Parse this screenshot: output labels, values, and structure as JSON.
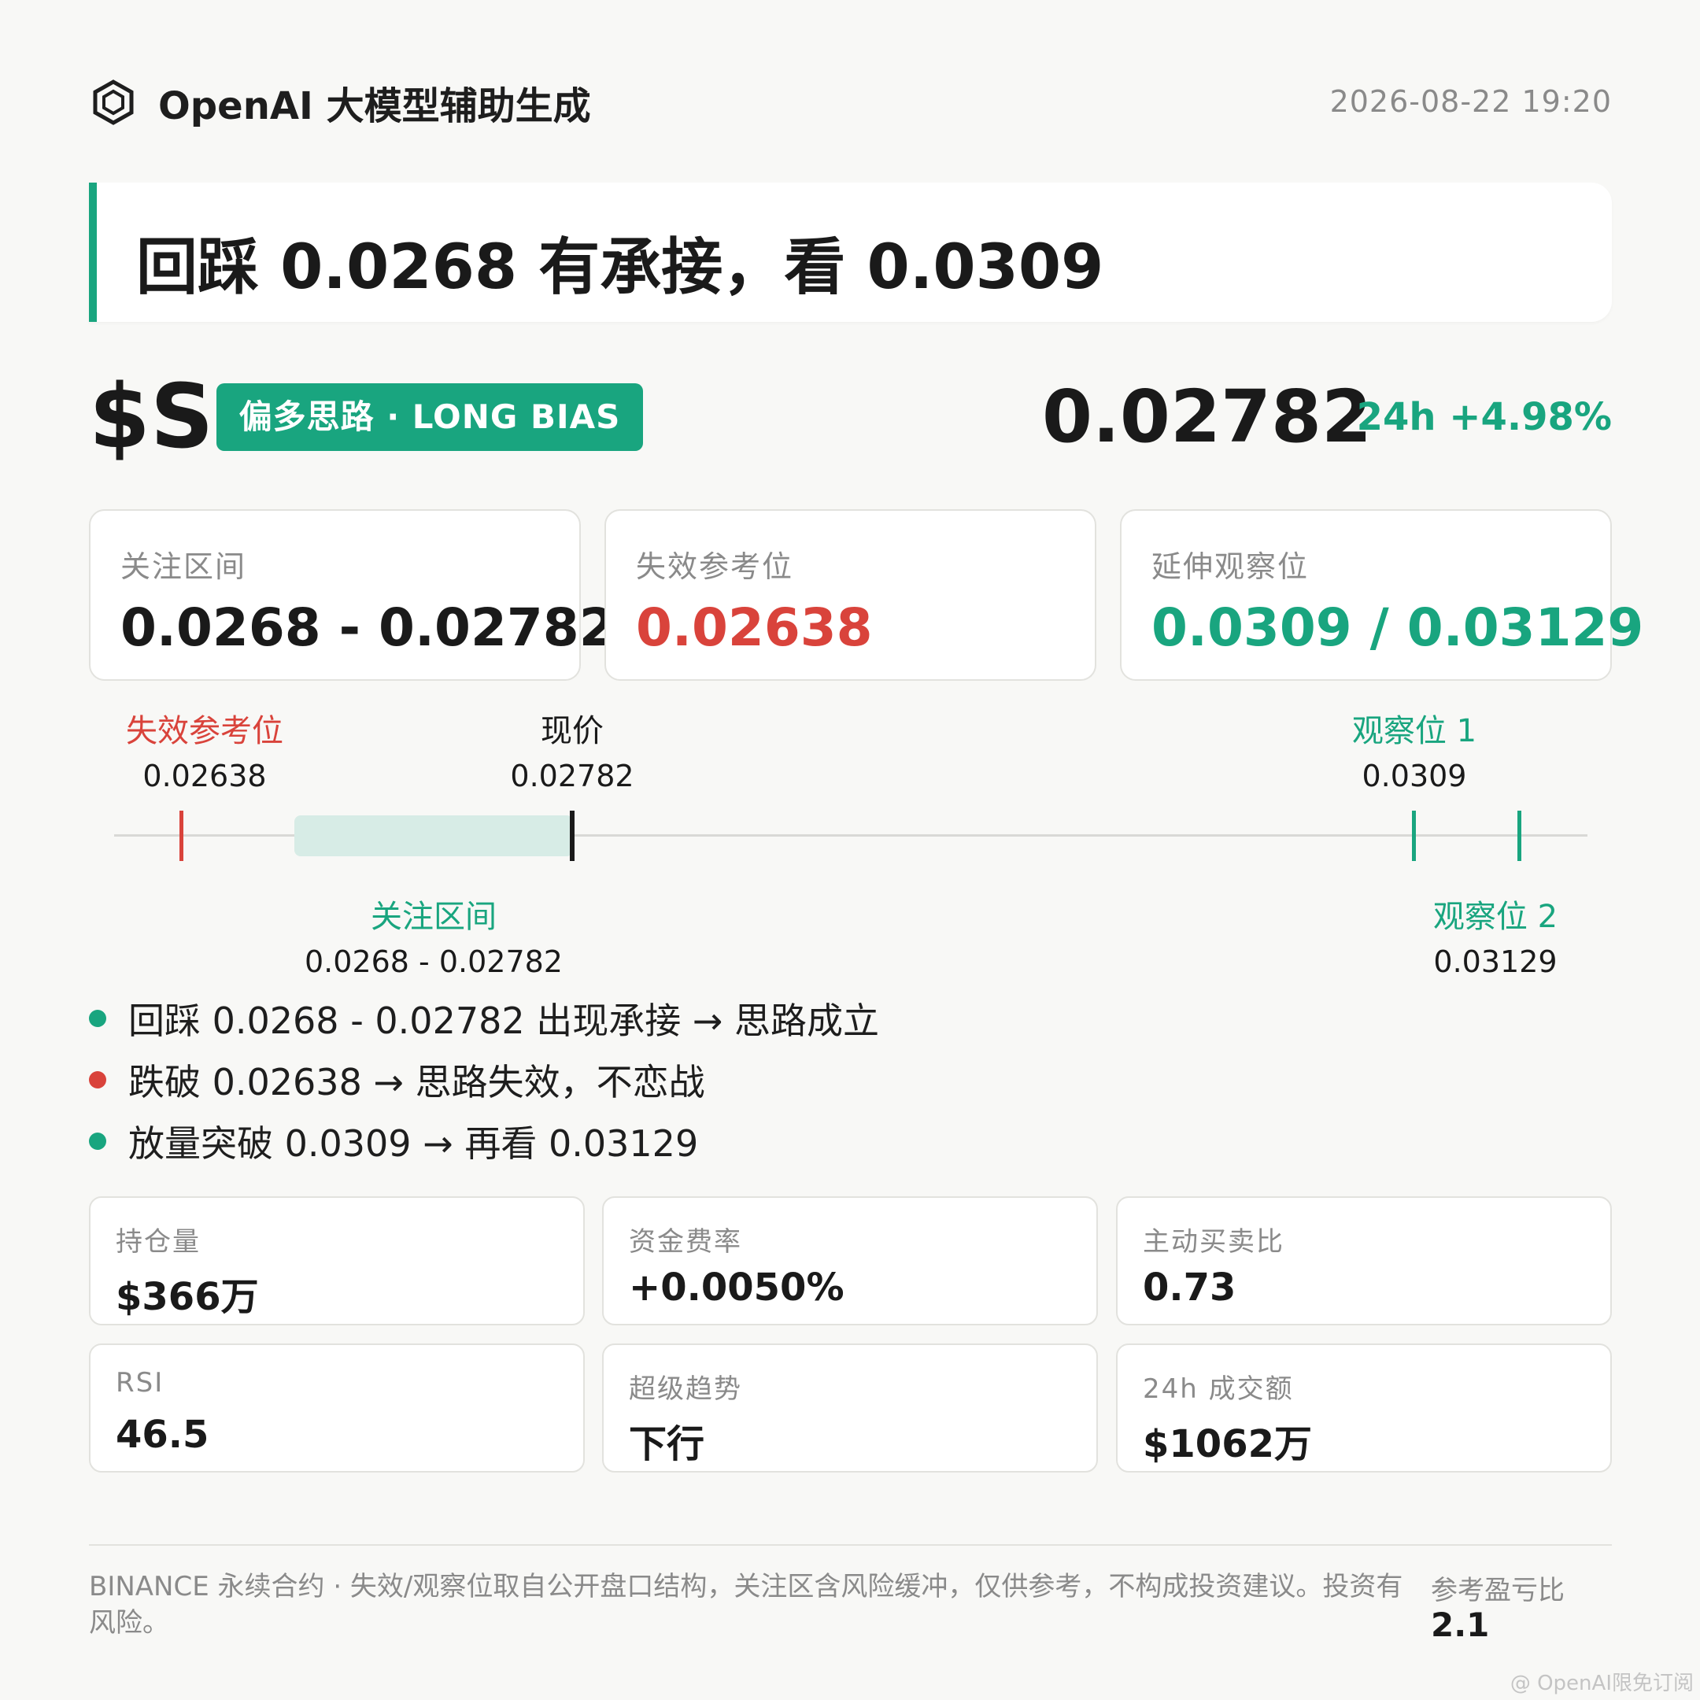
{
  "header": {
    "brand": "OpenAI 大模型辅助生成",
    "brand_icon": "openai-hexagon-icon",
    "timestamp": "2026-08-22 19:20"
  },
  "headline": "回踩 0.0268 有承接，看 0.0309",
  "ticker": {
    "symbol": "$S",
    "bias": "偏多思路 · LONG BIAS",
    "price": "0.02782",
    "change": "24h +4.98%"
  },
  "levels": [
    {
      "label": "关注区间",
      "value": "0.0268 - 0.02782",
      "color": "#1a1a1a"
    },
    {
      "label": "失效参考位",
      "value": "0.02638",
      "color": "#d9433b"
    },
    {
      "label": "延伸观察位",
      "value": "0.0309 / 0.03129",
      "color": "#19a57f"
    }
  ],
  "ruler": {
    "invalid": {
      "name": "失效参考位",
      "value": "0.02638"
    },
    "current": {
      "name": "现价",
      "value": "0.02782"
    },
    "target1": {
      "name": "观察位 1",
      "value": "0.0309"
    },
    "target2": {
      "name": "观察位 2",
      "value": "0.03129"
    },
    "zone": {
      "name": "关注区间",
      "value": "0.0268 - 0.02782"
    }
  },
  "bullets": [
    {
      "text": "回踩 0.0268 - 0.02782 出现承接 → 思路成立",
      "color": "#19a57f"
    },
    {
      "text": "跌破 0.02638 → 思路失效，不恋战",
      "color": "#d9433b"
    },
    {
      "text": "放量突破 0.0309 → 再看 0.03129",
      "color": "#19a57f"
    }
  ],
  "metrics": [
    {
      "label": "持仓量",
      "value": "$366万"
    },
    {
      "label": "资金费率",
      "value": "+0.0050%"
    },
    {
      "label": "主动买卖比",
      "value": "0.73"
    },
    {
      "label": "RSI",
      "value": "46.5"
    },
    {
      "label": "超级趋势",
      "value": "下行"
    },
    {
      "label": "24h 成交额",
      "value": "$1062万"
    }
  ],
  "footer": {
    "disclaimer": "BINANCE 永续合约 · 失效/观察位取自公开盘口结构，关注区含风险缓冲，仅供参考，不构成投资建议。投资有风险。",
    "rr_label": "参考盈亏比",
    "rr_value": "2.1"
  },
  "watermark": "@ OpenAI限免订阅",
  "colors": {
    "accent": "#19a57f",
    "danger": "#d9433b"
  }
}
